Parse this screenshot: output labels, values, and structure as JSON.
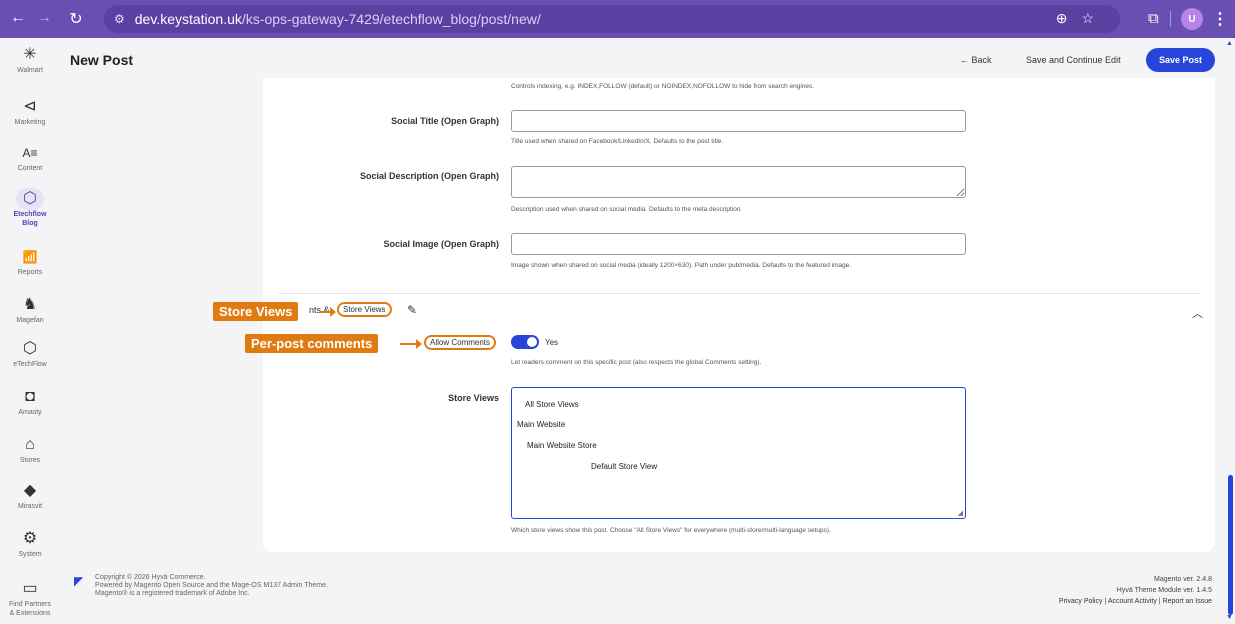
{
  "browser": {
    "url_host": "dev.keystation.uk",
    "url_path": "/ks-ops-gateway-7429/etechflow_blog/post/new/",
    "profile_initial": "U"
  },
  "sidebar": {
    "items": [
      {
        "label": "Walmart",
        "icon": "walmart-spark-icon",
        "glyph": "✳"
      },
      {
        "label": "Marketing",
        "icon": "megaphone-icon",
        "glyph": "⊲"
      },
      {
        "label": "Content",
        "icon": "content-icon",
        "glyph": "A≡"
      },
      {
        "label": "Etechflow Blog",
        "icon": "cube-icon",
        "glyph": "⬡"
      },
      {
        "label": "Reports",
        "icon": "reports-icon",
        "glyph": "📶"
      },
      {
        "label": "Magefan",
        "icon": "magefan-icon",
        "glyph": "♞"
      },
      {
        "label": "eTechFlow",
        "icon": "cube-icon",
        "glyph": "⬡"
      },
      {
        "label": "Amasty",
        "icon": "amasty-icon",
        "glyph": "◘"
      },
      {
        "label": "Stores",
        "icon": "store-icon",
        "glyph": "⌂"
      },
      {
        "label": "Mirasvit",
        "icon": "mirasvit-icon",
        "glyph": "◆"
      },
      {
        "label": "System",
        "icon": "gear-icon",
        "glyph": "⚙"
      },
      {
        "label": "Find Partners & Extensions",
        "icon": "box-icon",
        "glyph": "▭"
      }
    ]
  },
  "header": {
    "title": "New Post",
    "back_label": "← Back",
    "save_continue_label": "Save and Continue Edit",
    "save_label": "Save Post"
  },
  "form": {
    "robots_hint": "Controls indexing, e.g. INDEX,FOLLOW (default) or NOINDEX,NOFOLLOW to hide from search engines.",
    "social_title_label": "Social Title (Open Graph)",
    "social_title_value": "",
    "social_title_hint": "Title used when shared on Facebook/LinkedIn/X. Defaults to the post title.",
    "social_desc_label": "Social Description (Open Graph)",
    "social_desc_value": "",
    "social_desc_hint": "Description used when shared on social media. Defaults to the meta description.",
    "social_image_label": "Social Image (Open Graph)",
    "social_image_value": "",
    "social_image_hint": "Image shown when shared on social media (ideally 1200×630). Path under pub/media. Defaults to the featured image.",
    "section_prefix": "nts &",
    "section_store_views": "Store Views",
    "allow_comments_label": "Allow Comments",
    "allow_comments_state": "Yes",
    "allow_comments_hint": "Let readers comment on this specific post (also respects the global Comments setting).",
    "store_views_label": "Store Views",
    "store_views_options": [
      "All Store Views",
      "Main Website",
      "Main Website Store",
      "Default Store View"
    ],
    "store_views_hint": "Which store views show this post. Choose \"All Store Views\" for everywhere (multi-store/multi-language setups)."
  },
  "annotations": {
    "store_views_callout": "Store Views",
    "comments_callout": "Per-post comments"
  },
  "footer": {
    "copyright": "Copyright © 2026 Hyvä Commerce.",
    "powered": "Powered by Magento Open Source and the Mage-OS M137 Admin Theme.",
    "trademark": "Magento® is a registered trademark of Adobe Inc.",
    "magento_version": "Magento ver. 2.4.8",
    "hyva_version": "Hyvä Theme Module ver. 1.4.5",
    "links": [
      "Privacy Policy",
      "Account Activity",
      "Report an Issue"
    ]
  },
  "colors": {
    "accent": "#2745d8",
    "browser_bar": "#6a4fb3",
    "callout": "#e07b12"
  }
}
